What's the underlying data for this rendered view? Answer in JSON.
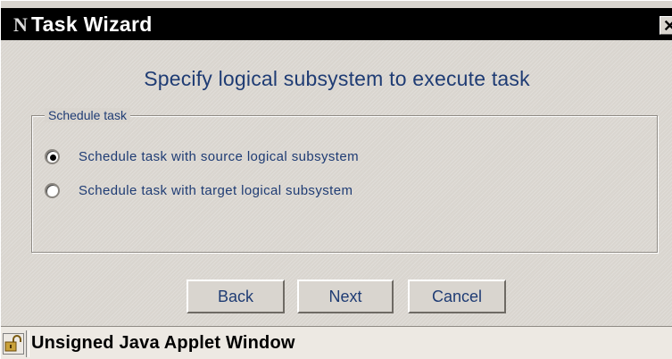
{
  "window": {
    "title": "Task Wizard",
    "app_icon_glyph": "N",
    "close_glyph": "✕"
  },
  "heading": "Specify logical subsystem to execute task",
  "group": {
    "legend": "Schedule task",
    "options": [
      {
        "label": "Schedule task with source logical subsystem",
        "selected": true
      },
      {
        "label": "Schedule task with target logical subsystem",
        "selected": false
      }
    ]
  },
  "buttons": {
    "back": "Back",
    "next": "Next",
    "cancel": "Cancel"
  },
  "status": {
    "text": "Unsigned Java Applet Window",
    "icon": "unlocked-padlock-icon"
  },
  "colors": {
    "accent_text": "#1f3c74",
    "window_bg": "#d9d5cf",
    "titlebar_bg": "#000000"
  }
}
